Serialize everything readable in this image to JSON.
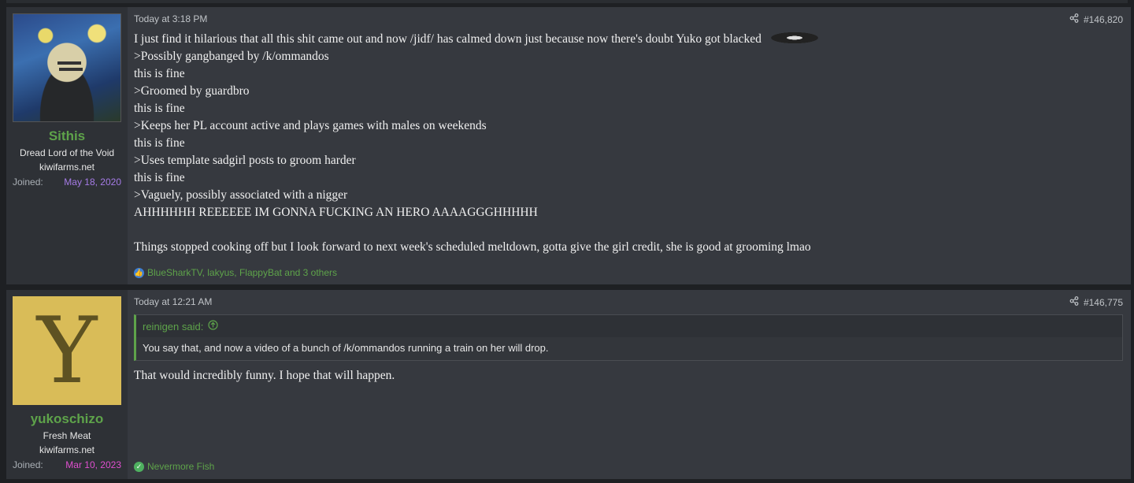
{
  "posts": [
    {
      "user": {
        "name": "Sithis",
        "title": "Dread Lord of the Void",
        "site": "kiwifarms.net",
        "joined_label": "Joined:",
        "joined_date": "May 18, 2020"
      },
      "time": "Today at 3:18 PM",
      "number": "#146,820",
      "lines": [
        "I just find it hilarious that all this shit came out and now /jidf/ has calmed down just because now there's doubt Yuko got blacked",
        ">Possibly gangbanged by /k/ommandos",
        "this is fine",
        ">Groomed by guardbro",
        "this is fine",
        ">Keeps her PL account active and plays games with males on weekends",
        "this is fine",
        ">Uses template sadgirl posts to groom harder",
        "this is fine",
        ">Vaguely, possibly associated with a nigger",
        "AHHHHHH REEEEEE IM GONNA FUCKING AN HERO AAAAGGGHHHHH",
        "",
        "Things stopped cooking off but I look forward to next week's scheduled meltdown, gotta give the girl credit, she is good at grooming lmao"
      ],
      "reactions": "BlueSharkTV, lakyus, FlappyBat and 3 others"
    },
    {
      "user": {
        "name": "yukoschizo",
        "avatar_letter": "Y",
        "title": "Fresh Meat",
        "site": "kiwifarms.net",
        "joined_label": "Joined:",
        "joined_date": "Mar 10, 2023"
      },
      "time": "Today at 12:21 AM",
      "number": "#146,775",
      "quote_author": "reinigen said:",
      "quote_text": "You say that, and now a video of a bunch of /k/ommandos running a train on her will drop.",
      "message": "That would incredibly funny. I hope that will happen.",
      "trophy": "Nevermore Fish"
    }
  ],
  "icons": {
    "share": "share-icon",
    "like": "like-icon",
    "check": "check-icon",
    "quote_up": "arrow-up-icon"
  }
}
